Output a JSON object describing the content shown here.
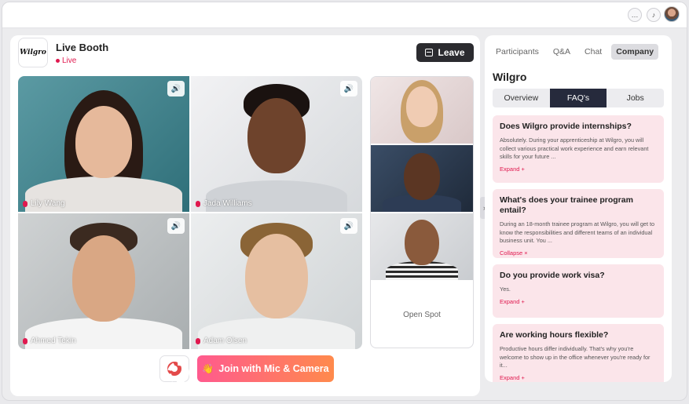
{
  "topbar": {
    "icons": [
      "chat-icon",
      "bell-icon"
    ],
    "avatar_icon": "user-avatar"
  },
  "booth": {
    "logo_text": "Wilgro",
    "title": "Live Booth",
    "status": "Live",
    "leave_label": "Leave",
    "participants": [
      {
        "name": "Lily Wang"
      },
      {
        "name": "Jada Williams"
      },
      {
        "name": "Ahmed Tekin"
      },
      {
        "name": "Adam Olsen"
      }
    ],
    "open_spot_label": "Open Spot",
    "join_label": "Join with Mic & Camera",
    "join_icon": "👋"
  },
  "panel": {
    "tabs": [
      "Participants",
      "Q&A",
      "Chat",
      "Company"
    ],
    "active_tab": "Company",
    "company_name": "Wilgro",
    "subtabs": [
      "Overview",
      "FAQ's",
      "Jobs"
    ],
    "active_subtab": "FAQ's",
    "faqs": [
      {
        "question": "Does Wilgro provide internships?",
        "answer": "Absolutely. During your apprenticeship at Wilgro, you will collect various practical work experience and earn relevant skills for your future ...",
        "toggle": "Expand +"
      },
      {
        "question": "What's does your trainee program entail?",
        "answer": "During an 18-month trainee program at Wilgro, you will get to know the responsibilities and different teams of an individual business unit. You ...",
        "toggle": "Collapse ×"
      },
      {
        "question": "Do you provide work visa?",
        "answer": "Yes.",
        "toggle": "Expand +"
      },
      {
        "question": "Are working hours flexible?",
        "answer": "Productive hours differ individually. That's why you're welcome to show up in the office whenever you're ready for it...",
        "toggle": "Expand +"
      }
    ]
  },
  "colors": {
    "accent": "#e0194f",
    "dark": "#262a3c",
    "join_start": "#ff5a8e",
    "join_end": "#ff8a4c",
    "faq_bg": "#fbe5ea"
  }
}
